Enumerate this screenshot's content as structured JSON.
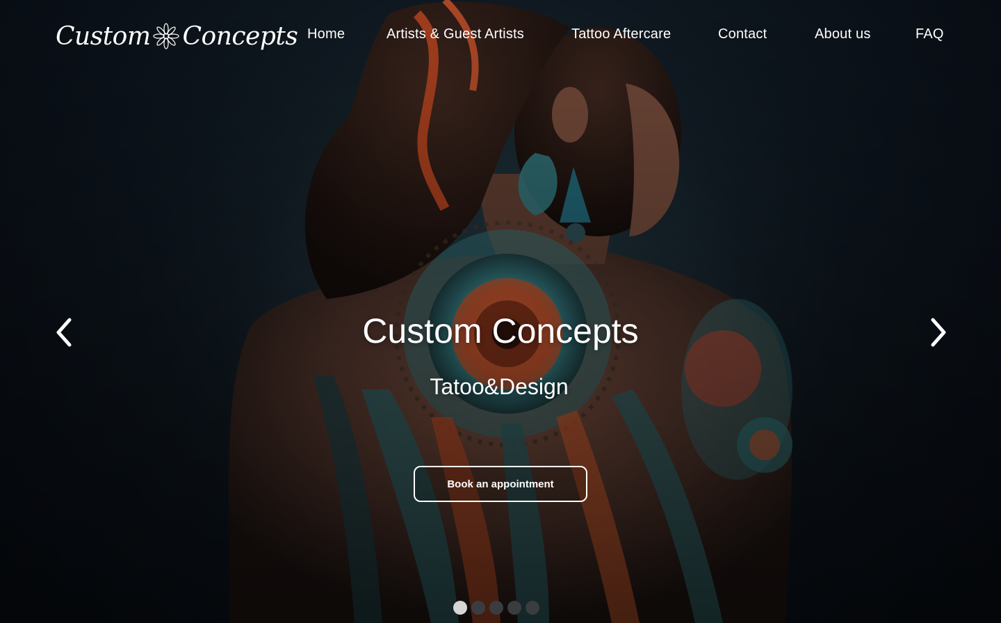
{
  "brand": {
    "logo_text_left": "Custom",
    "logo_text_right": "Concepts"
  },
  "nav": {
    "items": [
      {
        "label": "Home"
      },
      {
        "label": "Artists & Guest Artists"
      },
      {
        "label": "Tattoo Aftercare"
      },
      {
        "label": "Contact"
      },
      {
        "label": "About us"
      },
      {
        "label": "FAQ"
      }
    ]
  },
  "hero": {
    "title": "Custom Concepts",
    "subtitle": "Tatoo&Design",
    "cta_label": "Book an appointment"
  },
  "carousel": {
    "prev_icon": "chevron-left-icon",
    "next_icon": "chevron-right-icon",
    "slide_count": 5,
    "active_index": 0
  },
  "colors": {
    "background": "#0a0f17",
    "text": "#ffffff",
    "dot_active": "#d6d6d6",
    "dot_inactive": "#3a3c40",
    "tattoo_orange": "#d9602b",
    "tattoo_teal": "#2f6f74"
  }
}
